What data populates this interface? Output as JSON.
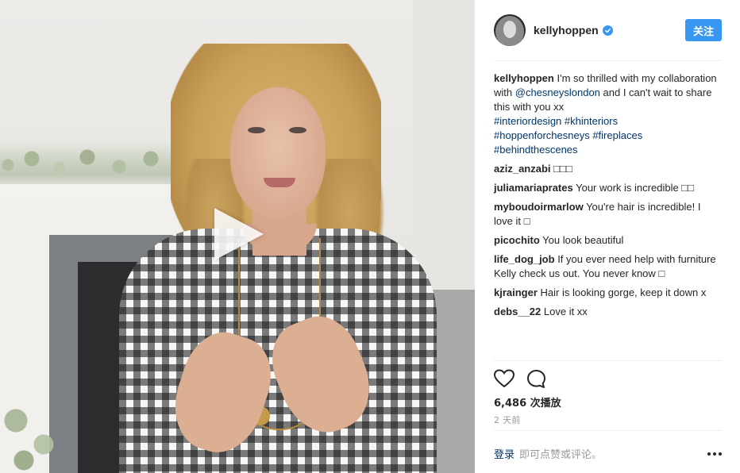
{
  "post": {
    "username": "kellyhoppen",
    "verified": true,
    "follow_label": "关注",
    "caption": {
      "user": "kellyhoppen",
      "text_1": "I'm so thrilled with my collaboration with",
      "mention": "@chesneyslondon",
      "text_2": "and I can't wait to share this with you xx",
      "hashtags": [
        "#interiordesign",
        "#khinteriors",
        "#hoppenforchesneys",
        "#fireplaces",
        "#behindthescenes"
      ]
    },
    "comments": [
      {
        "user": "aziz_anzabi",
        "text": "□□□"
      },
      {
        "user": "juliamariaprates",
        "text": "Your work is incredible □□"
      },
      {
        "user": "myboudoirmarlow",
        "text": "You're hair is incredible! I love it □"
      },
      {
        "user": "picochito",
        "text": "You look beautiful"
      },
      {
        "user": "life_dog_job",
        "text": "If you ever need help with furniture Kelly check us out. You never know □"
      },
      {
        "user": "kjrainger",
        "text": "Hair is looking gorge, keep it down x"
      },
      {
        "user": "debs__22",
        "text": "Love it xx"
      }
    ],
    "views_text": "6,486 次播放",
    "time_ago": "2 天前",
    "footer": {
      "login_label": "登录",
      "hint": "即可点赞或评论。"
    },
    "icons": {
      "like": "heart-icon",
      "comment": "comment-bubble-icon",
      "more": "more-options-icon",
      "play": "play-icon",
      "verified": "verified-badge-icon"
    },
    "colors": {
      "accent": "#3897f0",
      "link": "#003569",
      "muted": "#999999",
      "text": "#262626"
    }
  }
}
